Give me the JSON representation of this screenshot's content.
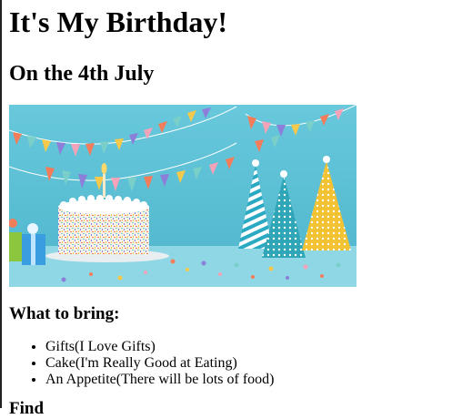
{
  "page": {
    "title": "It's My Birthday!",
    "subtitle": "On the 4th July",
    "list_heading": "What to bring:",
    "items": [
      {
        "label": "Gifts(I Love Gifts)"
      },
      {
        "label": "Cake(I'm Really Good at Eating)"
      },
      {
        "label": "An Appetite(There will be lots of food)"
      }
    ],
    "next_heading": "Find"
  },
  "image": {
    "background_color": "#5ec3d8",
    "accent_colors": [
      "#f4a3b9",
      "#7ad0c8",
      "#f6c94a",
      "#8b7fd9",
      "#f37d5a"
    ]
  }
}
